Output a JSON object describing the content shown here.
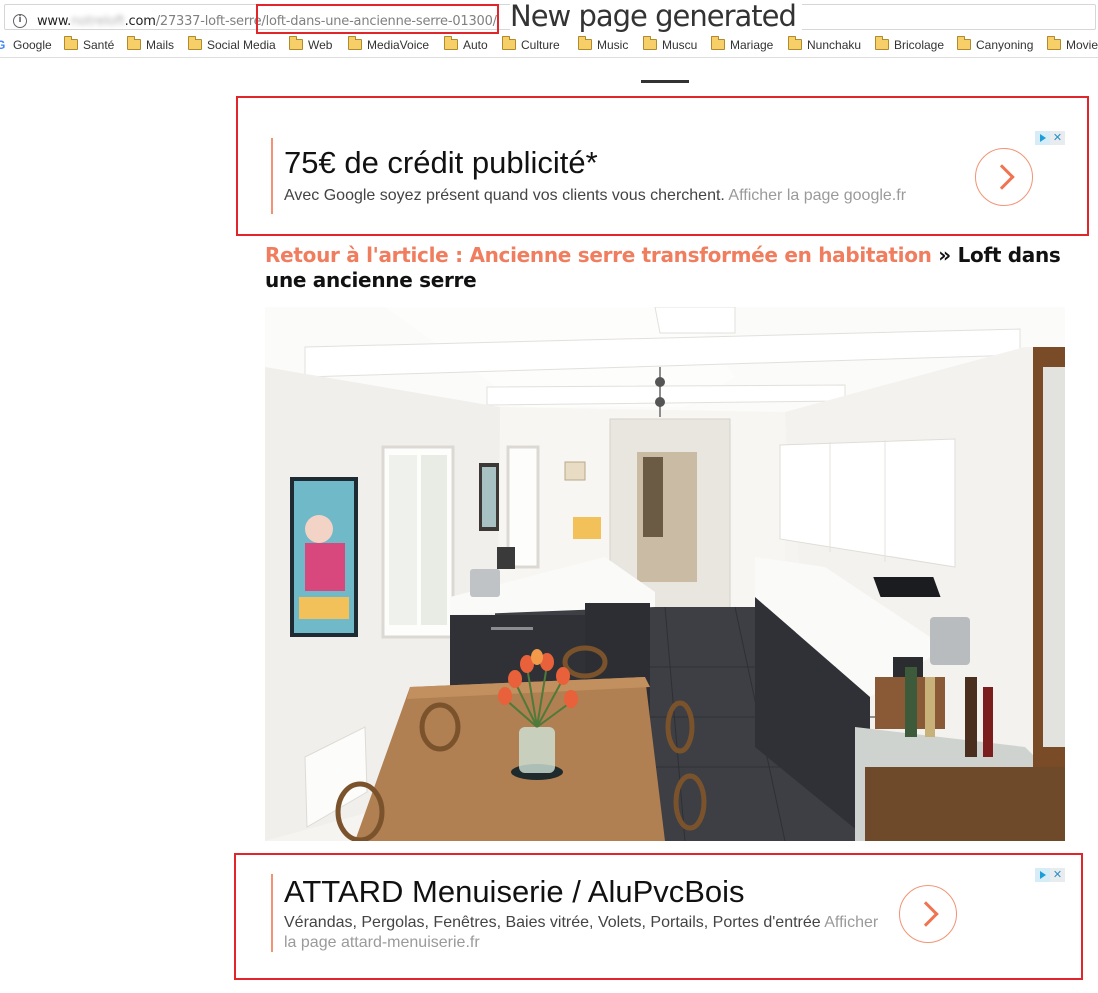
{
  "browser": {
    "url_prefix": "www.",
    "url_domain": "notreloft",
    "url_mid": ".com",
    "url_path_start": "/27337-loft-serre",
    "url_path_highlight": "/loft-dans-une-ancienne-serre-01300/",
    "annotation": "New page generated"
  },
  "bookmarks": [
    {
      "label": "Google",
      "icon": "google-icon"
    },
    {
      "label": "Santé",
      "icon": "folder-icon"
    },
    {
      "label": "Mails",
      "icon": "folder-icon"
    },
    {
      "label": "Social Media",
      "icon": "folder-icon"
    },
    {
      "label": "Web",
      "icon": "folder-icon"
    },
    {
      "label": "MediaVoice",
      "icon": "folder-icon"
    },
    {
      "label": "Auto",
      "icon": "folder-icon"
    },
    {
      "label": "Culture",
      "icon": "folder-icon"
    },
    {
      "label": "Music",
      "icon": "folder-icon"
    },
    {
      "label": "Muscu",
      "icon": "folder-icon"
    },
    {
      "label": "Mariage",
      "icon": "folder-icon"
    },
    {
      "label": "Nunchaku",
      "icon": "folder-icon"
    },
    {
      "label": "Bricolage",
      "icon": "folder-icon"
    },
    {
      "label": "Canyoning",
      "icon": "folder-icon"
    },
    {
      "label": "Movie",
      "icon": "folder-icon"
    }
  ],
  "ad_top": {
    "headline": "75€ de crédit publicité*",
    "text": "Avec Google soyez présent quand vos clients vous cherchent.",
    "link": "Afficher la page google.fr"
  },
  "breadcrumb": {
    "back_link": "Retour à l'article : Ancienne serre transformée en habitation",
    "separator": "»",
    "current": "Loft dans une ancienne serre"
  },
  "ad_bottom": {
    "headline": "ATTARD Menuiserie / AluPvcBois",
    "text": "Vérandas, Pergolas, Fenêtres, Baies vitrée, Volets, Portails, Portes d'entrée",
    "link": "Afficher la page attard-menuiserie.fr"
  },
  "colors": {
    "highlight_red": "#e0262b",
    "accent_orange": "#f07d5e",
    "adchoices_blue": "#1b9ed8"
  }
}
